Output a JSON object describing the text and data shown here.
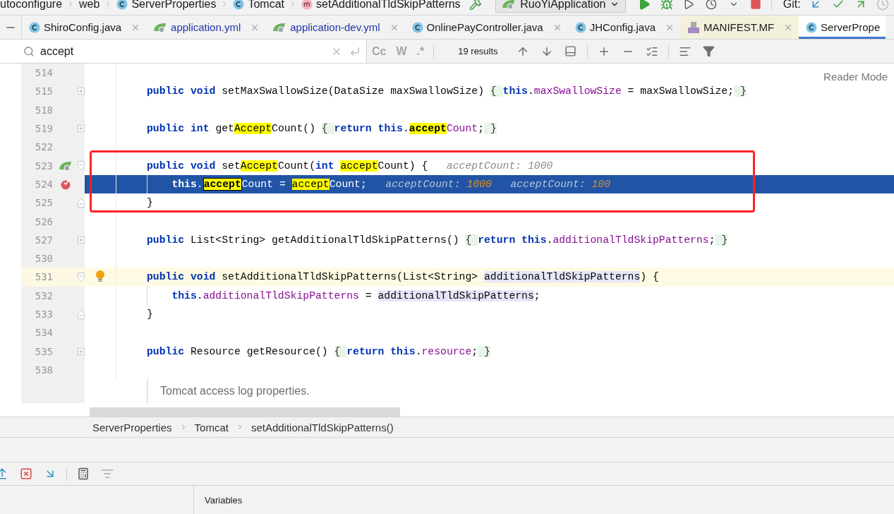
{
  "navigation_bar": {
    "breadcrumbs": [
      {
        "label": "utoconfigure",
        "kind": "folder"
      },
      {
        "label": "web",
        "kind": "folder"
      },
      {
        "label": "ServerProperties",
        "kind": "class"
      },
      {
        "label": "Tomcat",
        "kind": "class"
      },
      {
        "label": "setAdditionalTldSkipPatterns",
        "kind": "method"
      }
    ],
    "run_configuration": "RuoYiApplication",
    "git_label": "Git:"
  },
  "tabs": [
    {
      "label": "ShiroConfig.java",
      "kind": "class",
      "modified": false,
      "external": false,
      "selected": false
    },
    {
      "label": "application.yml",
      "kind": "spring",
      "modified": true,
      "external": false,
      "selected": false
    },
    {
      "label": "application-dev.yml",
      "kind": "spring",
      "modified": true,
      "external": false,
      "selected": false
    },
    {
      "label": "OnlinePayController.java",
      "kind": "class",
      "modified": false,
      "external": false,
      "selected": false
    },
    {
      "label": "JHConfig.java",
      "kind": "class",
      "modified": false,
      "external": false,
      "selected": false
    },
    {
      "label": "MANIFEST.MF",
      "kind": "manifest",
      "modified": false,
      "external": true,
      "selected": false
    },
    {
      "label": "ServerPrope",
      "kind": "class",
      "modified": false,
      "external": false,
      "selected": true
    }
  ],
  "search": {
    "query": "accept",
    "result_count": "19 results",
    "toggles": [
      {
        "label": "Cc",
        "on": false
      },
      {
        "label": "W",
        "on": false
      },
      {
        "label": ".*",
        "on": false
      }
    ]
  },
  "editor": {
    "reader_mode": "Reader Mode",
    "lines": [
      {
        "number": "514",
        "execution_point": false,
        "caret_line": false
      },
      {
        "number": "515",
        "execution_point": false,
        "caret_line": false,
        "gutter": [
          {
            "kind": "fold_collapsed"
          }
        ],
        "tokens": [
          {
            "kind": "kw",
            "text": "public "
          },
          {
            "kind": "kw",
            "text": "void "
          },
          {
            "kind": "text",
            "text": "setMaxSwallowSize(DataSize maxSwallowSize) "
          },
          {
            "kind": "fold",
            "text": "{ "
          },
          {
            "kind": "kw",
            "text": "this"
          },
          {
            "kind": "text",
            "text": "."
          },
          {
            "kind": "field",
            "text": "maxSwallowSize"
          },
          {
            "kind": "text",
            "text": " = maxSwallowSize;"
          },
          {
            "kind": "fold",
            "text": " }"
          }
        ]
      },
      {
        "number": "518",
        "execution_point": false,
        "caret_line": false
      },
      {
        "number": "519",
        "execution_point": false,
        "caret_line": false,
        "gutter": [
          {
            "kind": "fold_collapsed"
          }
        ],
        "tokens": [
          {
            "kind": "kw",
            "text": "public "
          },
          {
            "kind": "kw",
            "text": "int "
          },
          {
            "kind": "text",
            "text": "get"
          },
          {
            "kind": "match",
            "text": "Accept"
          },
          {
            "kind": "text",
            "text": "Count() "
          },
          {
            "kind": "fold",
            "text": "{ "
          },
          {
            "kind": "kw",
            "text": "return "
          },
          {
            "kind": "kw",
            "text": "this"
          },
          {
            "kind": "text",
            "text": "."
          },
          {
            "kind": "match",
            "text": "accept"
          },
          {
            "kind": "field",
            "text": "Count"
          },
          {
            "kind": "text",
            "text": ";"
          },
          {
            "kind": "fold",
            "text": " }"
          }
        ]
      },
      {
        "number": "522",
        "execution_point": false,
        "caret_line": false
      },
      {
        "number": "523",
        "execution_point": false,
        "caret_line": false,
        "gutter": [
          {
            "kind": "bean"
          },
          {
            "kind": "fold_open"
          }
        ],
        "tokens": [
          {
            "kind": "kw",
            "text": "public "
          },
          {
            "kind": "kw",
            "text": "void "
          },
          {
            "kind": "text",
            "text": "set"
          },
          {
            "kind": "match",
            "text": "Accept"
          },
          {
            "kind": "text",
            "text": "Count("
          },
          {
            "kind": "kw",
            "text": "int "
          },
          {
            "kind": "match",
            "text": "accept"
          },
          {
            "kind": "text",
            "text": "Count) {"
          },
          {
            "kind": "hint",
            "text": "acceptCount:",
            "value": "1000"
          }
        ],
        "children": [
          {
            "number": "524",
            "execution_point": true,
            "caret_line": false,
            "gutter": [
              {
                "kind": "breakpoint"
              }
            ],
            "tokens": [
              {
                "kind": "kw",
                "text": "this"
              },
              {
                "kind": "text",
                "text": "."
              },
              {
                "kind": "match_current",
                "text": "accept"
              },
              {
                "kind": "field",
                "text": "Count"
              },
              {
                "kind": "text",
                "text": " = "
              },
              {
                "kind": "match",
                "text": "accept"
              },
              {
                "kind": "text",
                "text": "Count;"
              },
              {
                "kind": "hint",
                "text": "acceptCount:",
                "value": "1000"
              },
              {
                "kind": "hint",
                "text": "acceptCount:",
                "value": "100"
              }
            ]
          }
        ]
      },
      {
        "number": "525",
        "execution_point": false,
        "caret_line": false,
        "gutter": [
          {
            "kind": "fold_end"
          }
        ],
        "tokens": [
          {
            "kind": "text",
            "text": "}"
          }
        ]
      },
      {
        "number": "526",
        "execution_point": false,
        "caret_line": false
      },
      {
        "number": "527",
        "execution_point": false,
        "caret_line": false,
        "gutter": [
          {
            "kind": "fold_collapsed"
          }
        ],
        "tokens": [
          {
            "kind": "kw",
            "text": "public "
          },
          {
            "kind": "text",
            "text": "List<String> getAdditionalTldSkipPatterns() "
          },
          {
            "kind": "fold",
            "text": "{ "
          },
          {
            "kind": "kw",
            "text": "return "
          },
          {
            "kind": "kw",
            "text": "this"
          },
          {
            "kind": "text",
            "text": "."
          },
          {
            "kind": "field",
            "text": "additionalTldSkipPatterns"
          },
          {
            "kind": "text",
            "text": ";"
          },
          {
            "kind": "fold",
            "text": " }"
          }
        ]
      },
      {
        "number": "530",
        "execution_point": false,
        "caret_line": false
      },
      {
        "number": "531",
        "execution_point": false,
        "caret_line": true,
        "gutter": [
          {
            "kind": "fold_open"
          },
          {
            "kind": "bulb"
          }
        ],
        "tokens": [
          {
            "kind": "kw",
            "text": "public "
          },
          {
            "kind": "kw",
            "text": "void "
          },
          {
            "kind": "text",
            "text": "setAdditionalTldSkipPatterns(List<String> "
          },
          {
            "kind": "usage",
            "text": "additionalTldSkipPatterns"
          },
          {
            "kind": "text",
            "text": ") {"
          }
        ],
        "children": [
          {
            "number": "532",
            "execution_point": false,
            "caret_line": false,
            "tokens": [
              {
                "kind": "kw",
                "text": "this"
              },
              {
                "kind": "text",
                "text": "."
              },
              {
                "kind": "field",
                "text": "additionalTldSkipPatterns"
              },
              {
                "kind": "text",
                "text": " = "
              },
              {
                "kind": "usage",
                "text": "additionalTldSkipPatterns"
              },
              {
                "kind": "text",
                "text": ";"
              }
            ]
          }
        ]
      },
      {
        "number": "533",
        "execution_point": false,
        "caret_line": false,
        "gutter": [
          {
            "kind": "fold_end"
          }
        ],
        "tokens": [
          {
            "kind": "text",
            "text": "}"
          }
        ]
      },
      {
        "number": "534",
        "execution_point": false,
        "caret_line": false
      },
      {
        "number": "535",
        "execution_point": false,
        "caret_line": false,
        "gutter": [
          {
            "kind": "fold_collapsed"
          }
        ],
        "tokens": [
          {
            "kind": "kw",
            "text": "public "
          },
          {
            "kind": "text",
            "text": "Resource getResource() "
          },
          {
            "kind": "fold",
            "text": "{ "
          },
          {
            "kind": "kw",
            "text": "return "
          },
          {
            "kind": "kw",
            "text": "this"
          },
          {
            "kind": "text",
            "text": "."
          },
          {
            "kind": "field",
            "text": "resource"
          },
          {
            "kind": "text",
            "text": ";"
          },
          {
            "kind": "fold",
            "text": " }"
          }
        ]
      },
      {
        "number": "538",
        "execution_point": false,
        "caret_line": false
      }
    ],
    "doc_comment": "Tomcat access log properties."
  },
  "status_breadcrumbs": [
    "ServerProperties",
    "Tomcat",
    "setAdditionalTldSkipPatterns()"
  ],
  "debug_panel": {
    "variables_title": "Variables"
  }
}
